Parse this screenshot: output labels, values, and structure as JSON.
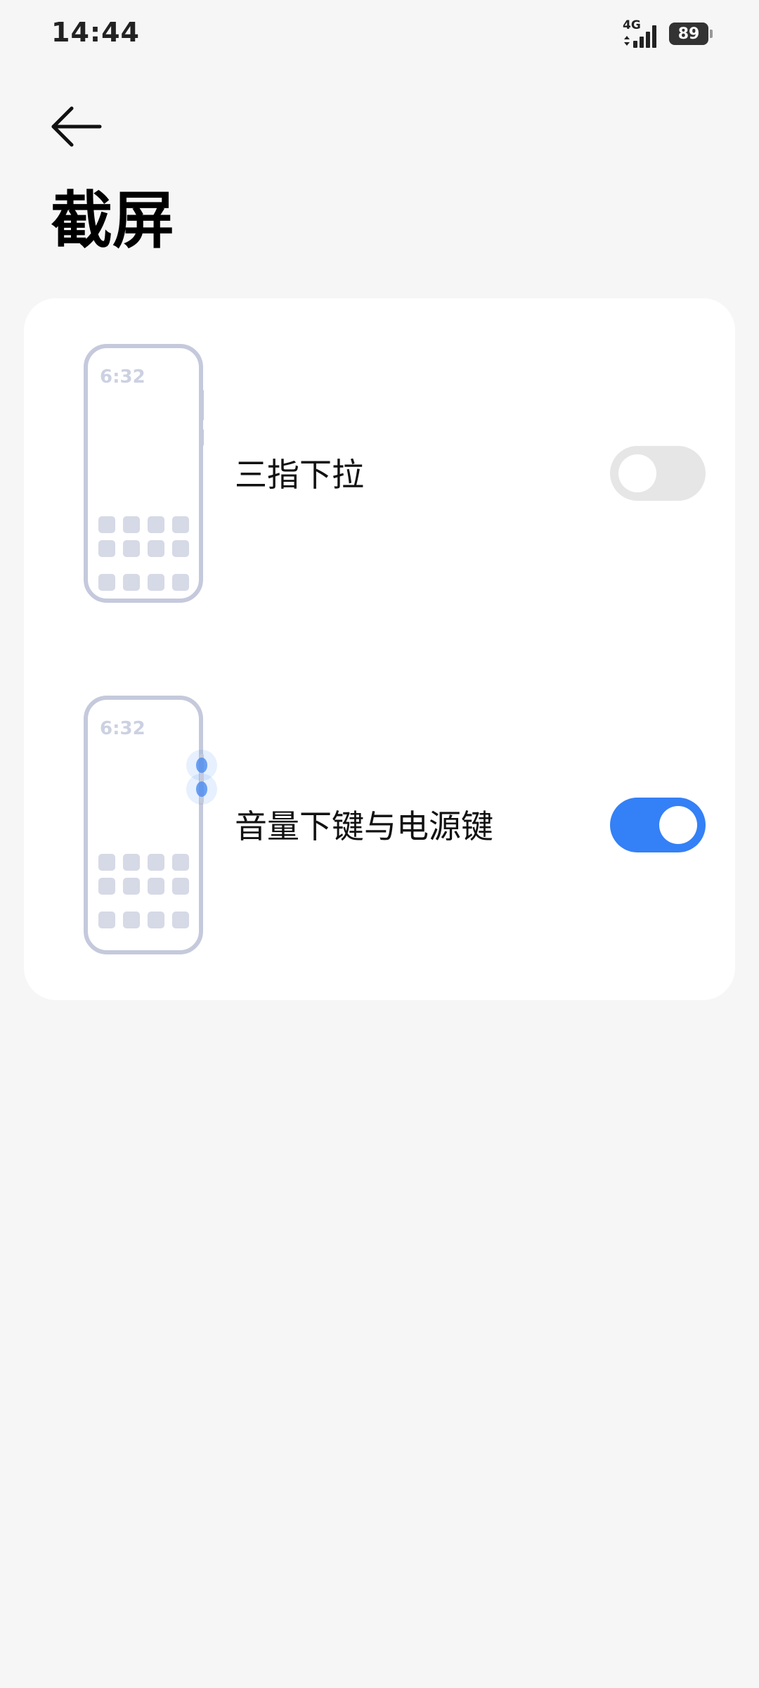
{
  "status_bar": {
    "time": "14:44",
    "network_type": "4G",
    "battery_level": "89",
    "signal_icon": "signal-bars-icon",
    "battery_icon": "battery-icon"
  },
  "header": {
    "back_icon": "arrow-left-icon",
    "title": "截屏"
  },
  "options": [
    {
      "label": "三指下拉",
      "enabled": false,
      "illustration_time": "6:32",
      "illustration_icon": "phone-three-finger-icon"
    },
    {
      "label": "音量下键与电源键",
      "enabled": true,
      "illustration_time": "6:32",
      "illustration_icon": "phone-buttons-icon"
    }
  ],
  "colors": {
    "background": "#f6f6f6",
    "card": "#ffffff",
    "toggle_on": "#3480f6",
    "toggle_off": "#e6e6e6",
    "illustration_stroke": "#c5c9dc",
    "illustration_fill": "#d6d9e6"
  }
}
